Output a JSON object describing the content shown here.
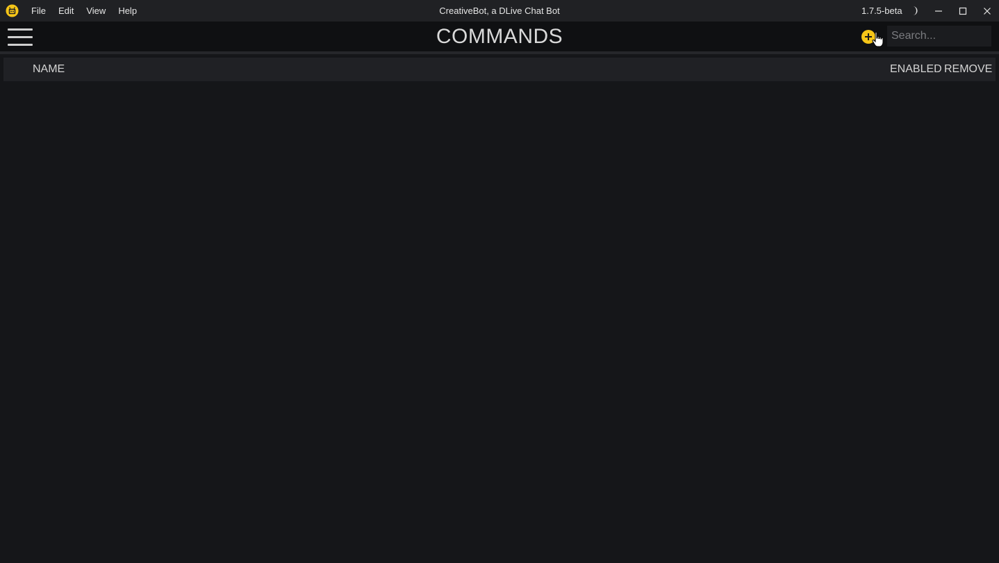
{
  "window": {
    "title": "CreativeBot, a DLive Chat Bot",
    "version": "1.7.5-beta"
  },
  "menu": {
    "items": [
      {
        "label": "File"
      },
      {
        "label": "Edit"
      },
      {
        "label": "View"
      },
      {
        "label": "Help"
      }
    ]
  },
  "icons": {
    "app_logo": "creativebot-logo-icon",
    "theme_toggle": "moon-icon",
    "minimize": "minimize-icon",
    "maximize": "maximize-icon",
    "close": "close-icon",
    "menu": "hamburger-icon",
    "add": "plus-circle-icon",
    "cursor": "hand-pointer-icon"
  },
  "colors": {
    "accent": "#f5c518",
    "background": "#151619",
    "titlebar": "#202124",
    "toolbar": "#0f1012",
    "header_row": "#202125"
  },
  "page": {
    "title": "COMMANDS"
  },
  "search": {
    "placeholder": "Search...",
    "value": ""
  },
  "table": {
    "columns": {
      "name": "NAME",
      "enabled": "ENABLED",
      "remove": "REMOVE"
    },
    "rows": []
  }
}
